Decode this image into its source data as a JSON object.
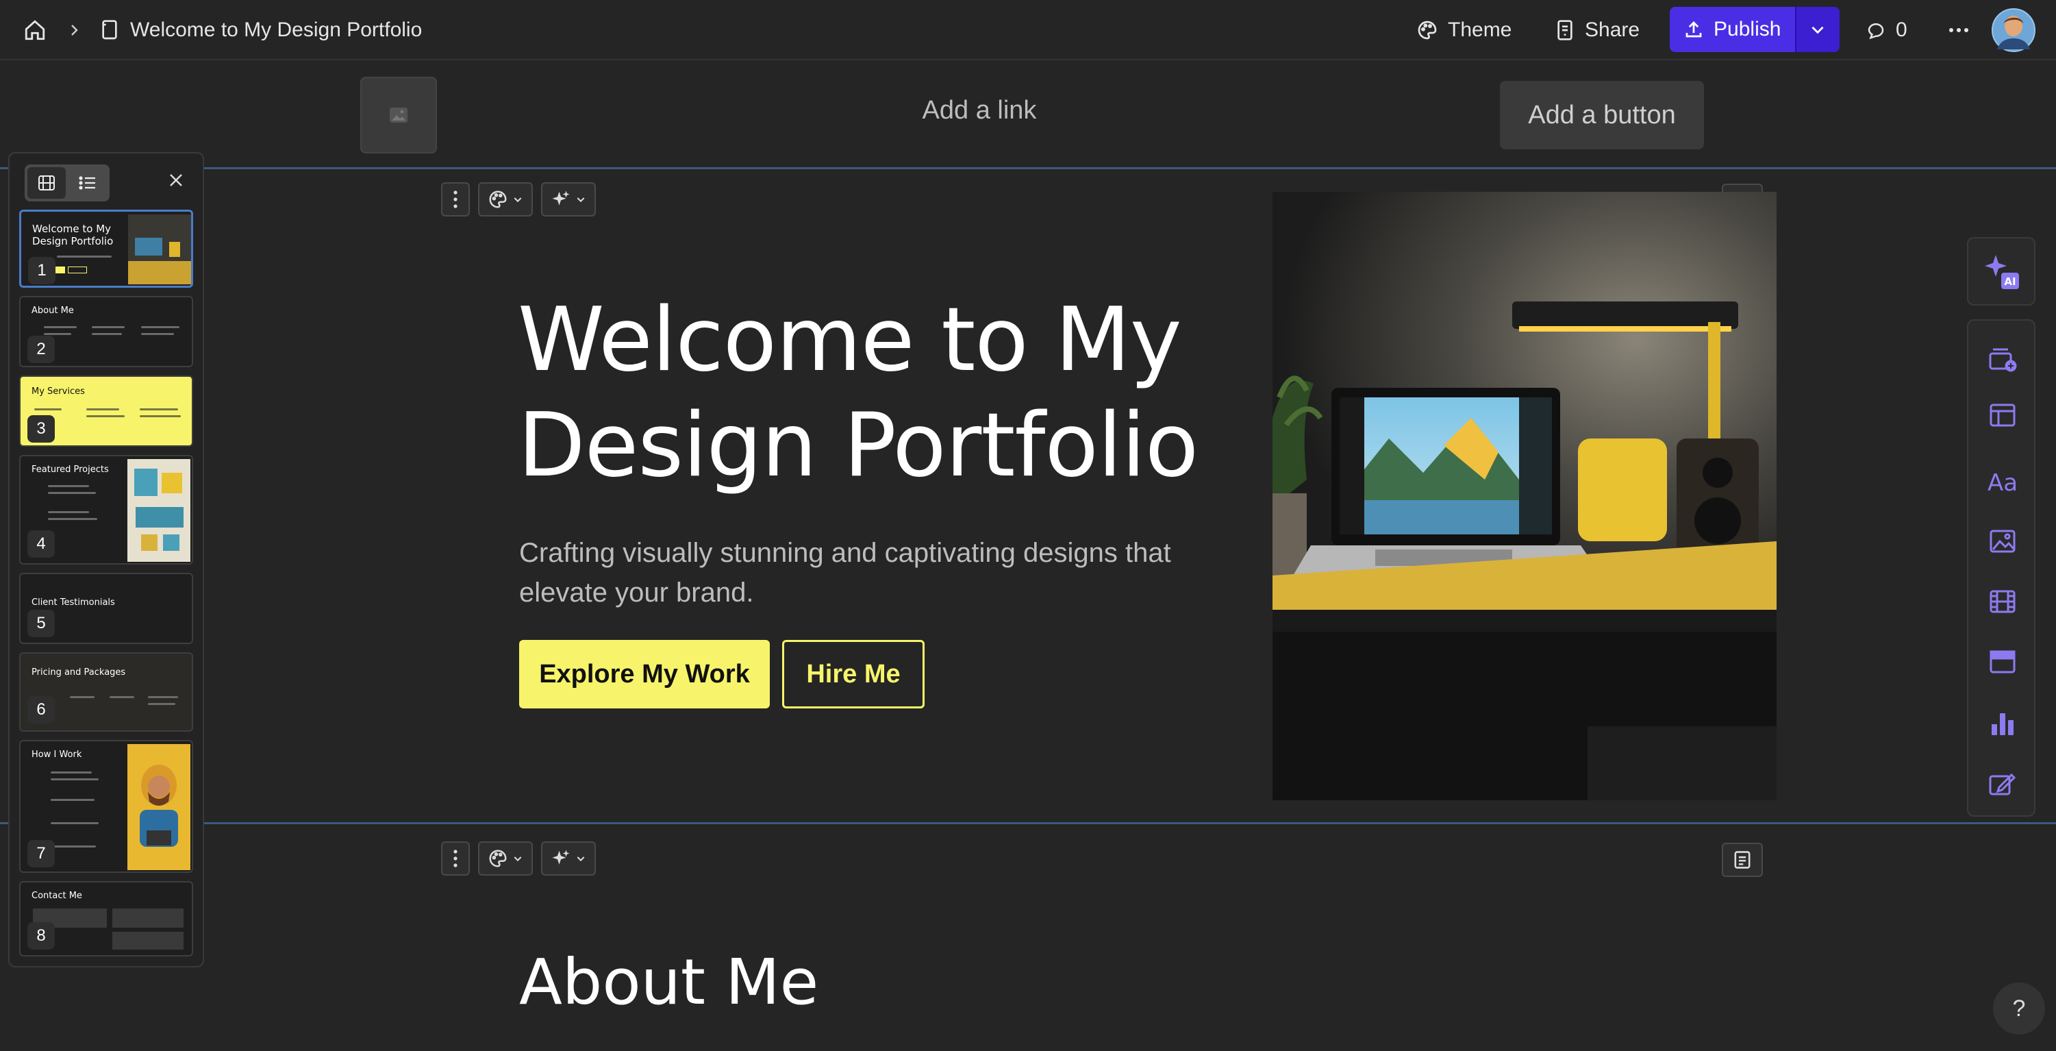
{
  "topbar": {
    "doc_title": "Welcome to My Design Portfolio",
    "theme_label": "Theme",
    "share_label": "Share",
    "publish_label": "Publish",
    "comment_count": "0"
  },
  "header_strip": {
    "link_label": "Add a link",
    "button_label": "Add a button"
  },
  "hero": {
    "title": "Welcome to My Design Portfolio",
    "subtitle": "Crafting visually stunning and captivating designs that elevate your brand.",
    "primary_button": "Explore My Work",
    "secondary_button": "Hire Me"
  },
  "next_section": {
    "title": "About Me"
  },
  "slides": [
    {
      "num": "1",
      "title": "Welcome to My Design Portfolio"
    },
    {
      "num": "2",
      "title": "About Me"
    },
    {
      "num": "3",
      "title": "My Services"
    },
    {
      "num": "4",
      "title": "Featured Projects"
    },
    {
      "num": "5",
      "title": "Client Testimonials"
    },
    {
      "num": "6",
      "title": "Pricing and Packages"
    },
    {
      "num": "7",
      "title": "How I Work"
    },
    {
      "num": "8",
      "title": "Contact Me"
    }
  ],
  "rail": {
    "ai_badge": "AI",
    "help": "?"
  },
  "colors": {
    "accent_yellow": "#f7f46b",
    "publish_purple": "#4a2ee6",
    "section_line": "#3c5a7c"
  }
}
